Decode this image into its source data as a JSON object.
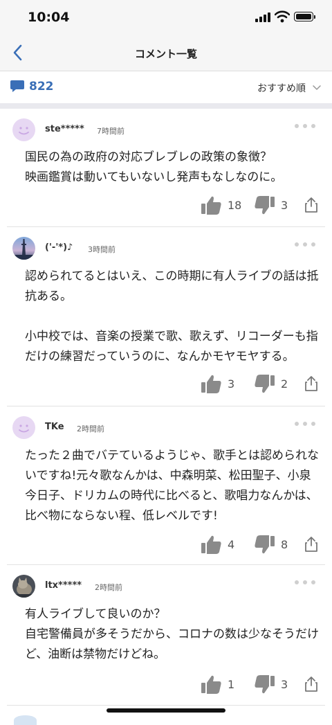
{
  "status": {
    "time": "10:04"
  },
  "header": {
    "title": "コメント一覧"
  },
  "toolbar": {
    "comment_count": "822",
    "sort_label": "おすすめ順"
  },
  "comments": [
    {
      "avatar_style": "smile",
      "username": "ste*****",
      "time": "7時間前",
      "body": "国民の為の政府の対応ブレブレの政策の象徴？\n映画鑑賞は動いてもいないし発声もなしなのに。",
      "likes": "18",
      "dislikes": "3"
    },
    {
      "avatar_style": "photo-tower",
      "username": "('-'*)♪",
      "time": "3時間前",
      "body": "認められてるとはいえ、この時期に有人ライブの話は抵抗ある。\n\n小中校では、音楽の授業で歌、歌えず、リコーダーも指だけの練習だっていうのに、なんかモヤモヤする。",
      "likes": "3",
      "dislikes": "2"
    },
    {
      "avatar_style": "smile",
      "username": "TKe",
      "time": "2時間前",
      "body": "たった２曲でバテているようじゃ、歌手とは認められないですね!元々歌なんかは、中森明菜、松田聖子、小泉今日子、ドリカムの時代に比べると、歌唱力なんかは、比べ物にならない程、低レベルです!",
      "likes": "4",
      "dislikes": "8"
    },
    {
      "avatar_style": "photo-cat",
      "username": "ltx*****",
      "time": "2時間前",
      "body": "有人ライブして良いのか？\n自宅警備員が多そうだから、コロナの数は少なそうだけど、油断は禁物だけどね。",
      "likes": "1",
      "dislikes": "3"
    }
  ],
  "colors": {
    "accent": "#3a6fb7",
    "icon_gray": "#8a8a8a",
    "avatar_smile": "#e7d8f3",
    "separator": "#e9e9ee"
  }
}
